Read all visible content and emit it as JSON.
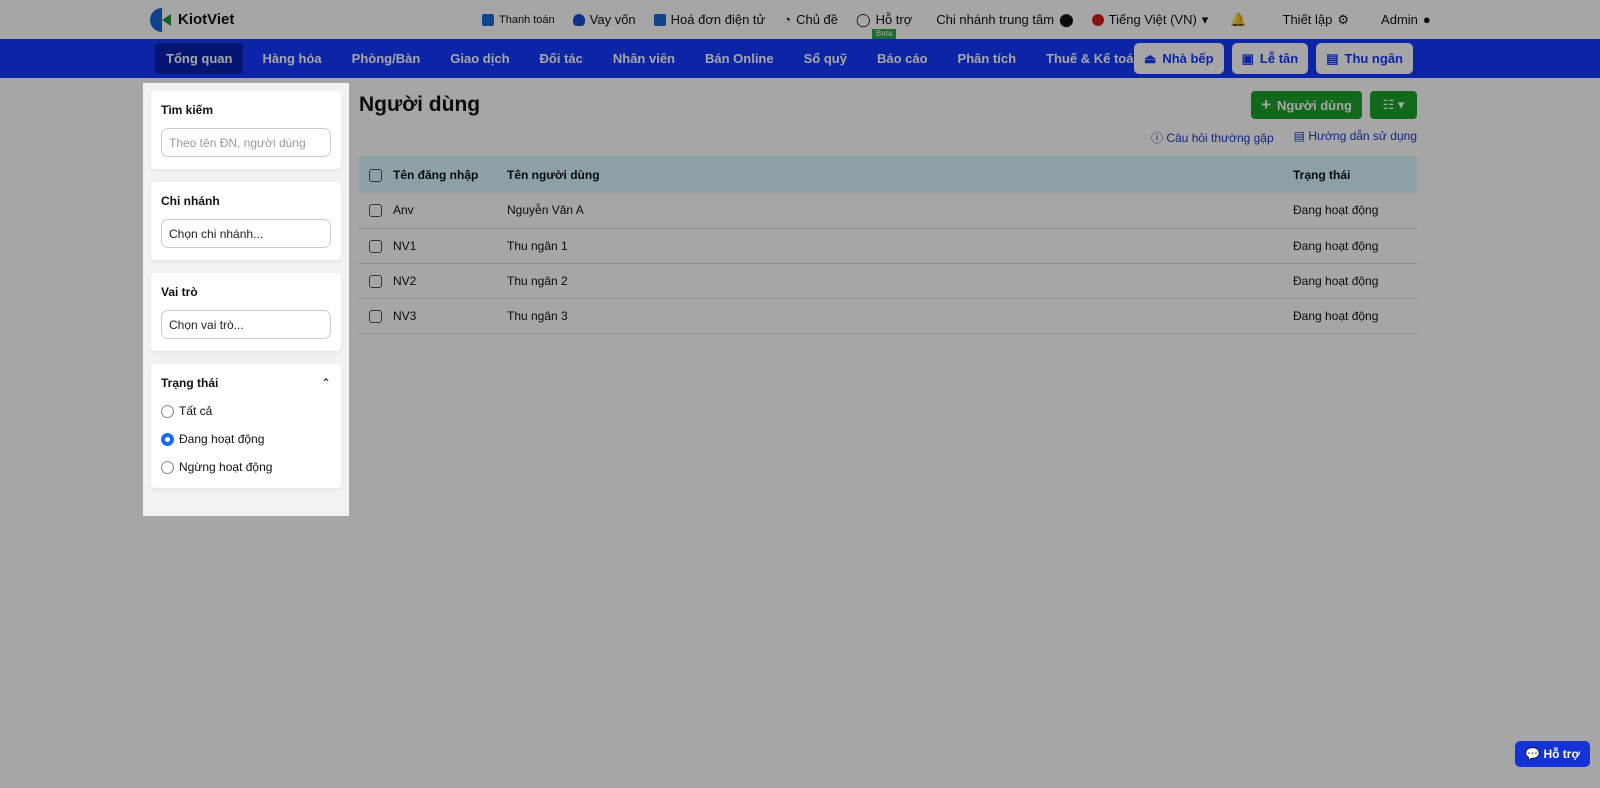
{
  "brand": "KiotViet",
  "toplinks": [
    "Thanh toán",
    "Vay vốn",
    "Hoá đơn điện tử",
    "Chủ đề",
    "Hỗ trợ"
  ],
  "beta": "Beta",
  "branch": "Chi nhánh trung tâm",
  "language": "Tiếng Việt (VN)",
  "settings": "Thiết lập",
  "user": "Admin",
  "nav": [
    "Tổng quan",
    "Hàng hóa",
    "Phòng/Bàn",
    "Giao dịch",
    "Đối tác",
    "Nhân viên",
    "Bán Online",
    "Sổ quỹ",
    "Báo cáo",
    "Phân tích",
    "Thuế & Kế toán"
  ],
  "navbtns": [
    "Nhà bếp",
    "Lễ tân",
    "Thu ngân"
  ],
  "filters": {
    "search_label": "Tìm kiếm",
    "search_placeholder": "Theo tên ĐN, người dùng",
    "branch_label": "Chi nhánh",
    "branch_placeholder": "Chọn chi nhánh...",
    "role_label": "Vai trò",
    "role_placeholder": "Chọn vai trò...",
    "status_label": "Trạng thái",
    "status_options": [
      "Tất cả",
      "Đang hoạt động",
      "Ngừng hoạt động"
    ],
    "status_selected": "Đang hoạt động"
  },
  "page": {
    "title": "Người dùng",
    "add": "Người dùng",
    "faq": "Câu hỏi thường gặp",
    "guide": "Hướng dẫn sử dụng"
  },
  "table": {
    "headers": [
      "Tên đăng nhập",
      "Tên người dùng",
      "Trạng thái"
    ],
    "rows": [
      [
        "Anv",
        "Nguyễn Văn A",
        "Đang hoạt động"
      ],
      [
        "NV1",
        "Thu ngân 1",
        "Đang hoạt động"
      ],
      [
        "NV2",
        "Thu ngân 2",
        "Đang hoạt động"
      ],
      [
        "NV3",
        "Thu ngân 3",
        "Đang hoạt động"
      ]
    ]
  },
  "support": "Hỗ trợ"
}
